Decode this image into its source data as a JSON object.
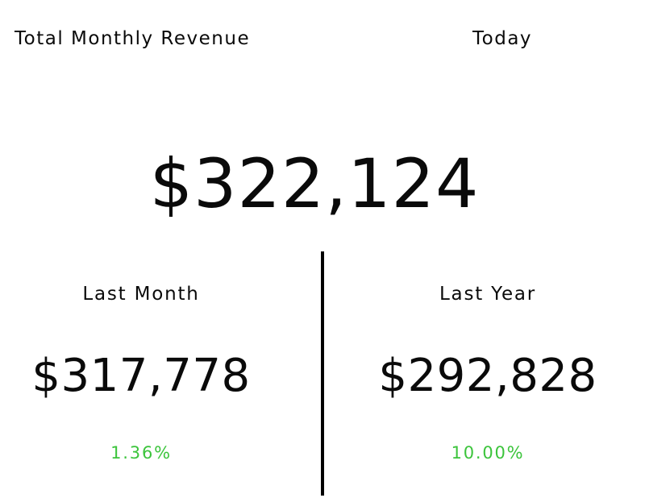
{
  "widget": {
    "title": "Total Monthly Revenue",
    "period": "Today",
    "current_value": "$322,124"
  },
  "comparisons": [
    {
      "label": "Last Month",
      "value": "$317,778",
      "change": "1.36%"
    },
    {
      "label": "Last Year",
      "value": "$292,828",
      "change": "10.00%"
    }
  ],
  "colors": {
    "text": "#0a0a0a",
    "positive_change": "#3cc43c",
    "divider": "#000000",
    "background": "#ffffff"
  }
}
